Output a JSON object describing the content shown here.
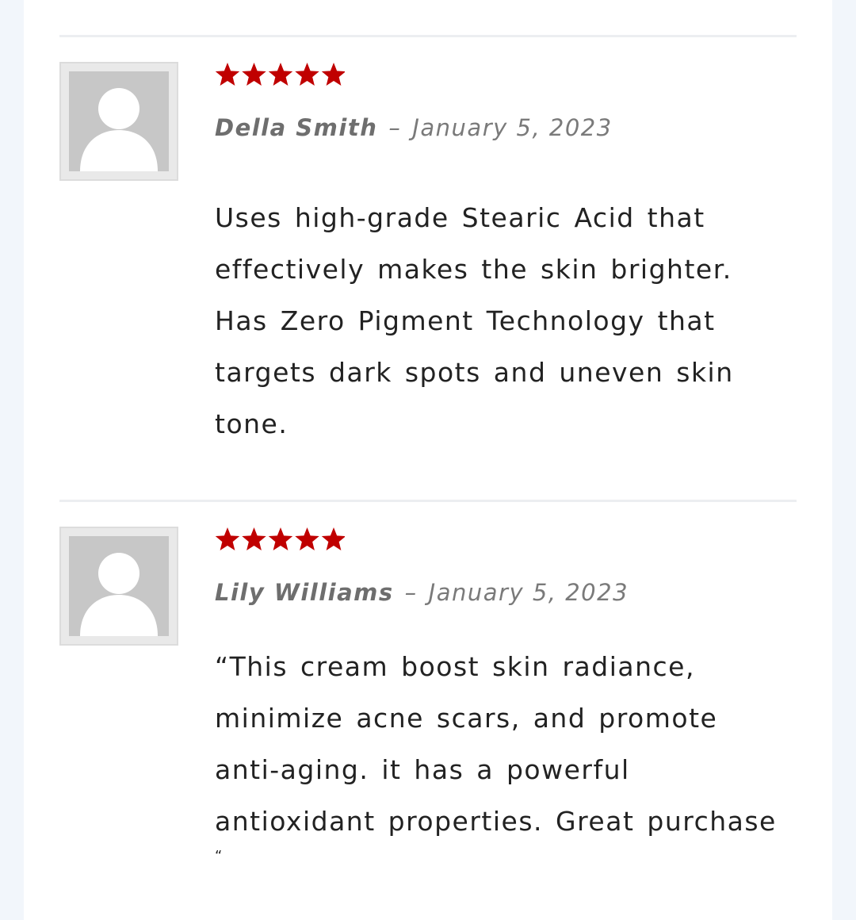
{
  "reviews": [
    {
      "rating": 5,
      "author": "Della Smith",
      "separator": "–",
      "date": "January 5, 2023",
      "text": "Uses high-grade Stearic Acid that effectively makes the skin brighter. Has Zero Pigment Technology that targets dark spots and uneven skin tone."
    },
    {
      "rating": 5,
      "author": "Lily Williams",
      "separator": "–",
      "date": "January 5, 2023",
      "text": "“This cream boost skin radiance, minimize acne scars, and promote anti-aging. it has a powerful antioxidant properties. Great purchase",
      "text_trailing": "“"
    }
  ],
  "colors": {
    "star": "#c00000",
    "page_bg": "#f2f6fb",
    "avatar_bg": "#c7c7c7"
  },
  "icons": {
    "star": "star-icon",
    "avatar": "default-avatar-icon"
  }
}
